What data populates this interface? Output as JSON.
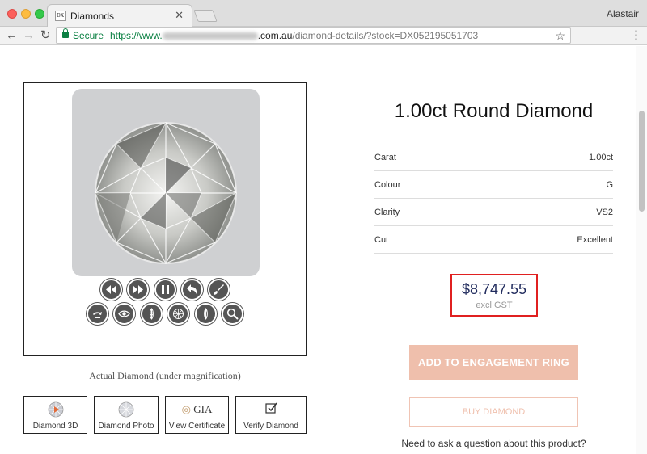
{
  "browser": {
    "tab_title": "Diamonds",
    "tab_favicon_text": "DX",
    "profile": "Alastair",
    "secure_label": "Secure",
    "url_scheme": "https://www.",
    "url_domain_end": ".com.au",
    "url_path": "/diamond-details/?stock=DX052195051703"
  },
  "viewer": {
    "controls_row1": [
      "rewind-icon",
      "fast-forward-icon",
      "pause-icon",
      "undo-icon",
      "brush-icon"
    ],
    "controls_row2": [
      "hand-rotate-icon",
      "eye-icon",
      "facet-side-icon",
      "facet-top-icon",
      "facet-bottom-icon",
      "zoom-icon"
    ],
    "caption": "Actual Diamond (under magnification)"
  },
  "view_buttons": [
    {
      "label": "Diamond 3D",
      "icon": "diamond-3d-icon"
    },
    {
      "label": "Diamond Photo",
      "icon": "diamond-photo-icon"
    },
    {
      "label": "View Certificate",
      "icon": "gia-logo-icon",
      "logo_text": "GIA"
    },
    {
      "label": "Verify Diamond",
      "icon": "verify-check-icon"
    }
  ],
  "product": {
    "title": "1.00ct Round Diamond",
    "specs": [
      {
        "key": "Carat",
        "value": "1.00ct"
      },
      {
        "key": "Colour",
        "value": "G"
      },
      {
        "key": "Clarity",
        "value": "VS2"
      },
      {
        "key": "Cut",
        "value": "Excellent"
      }
    ],
    "price": "$8,747.55",
    "price_note": "excl GST",
    "add_ring_label": "ADD TO ENGAGEMENT RING",
    "buy_label": "BUY DIAMOND",
    "question": "Need to ask a question about this product?"
  },
  "colors": {
    "accent": "#efbfac",
    "price": "#1f2a5c",
    "highlight_box": "#e02020"
  }
}
